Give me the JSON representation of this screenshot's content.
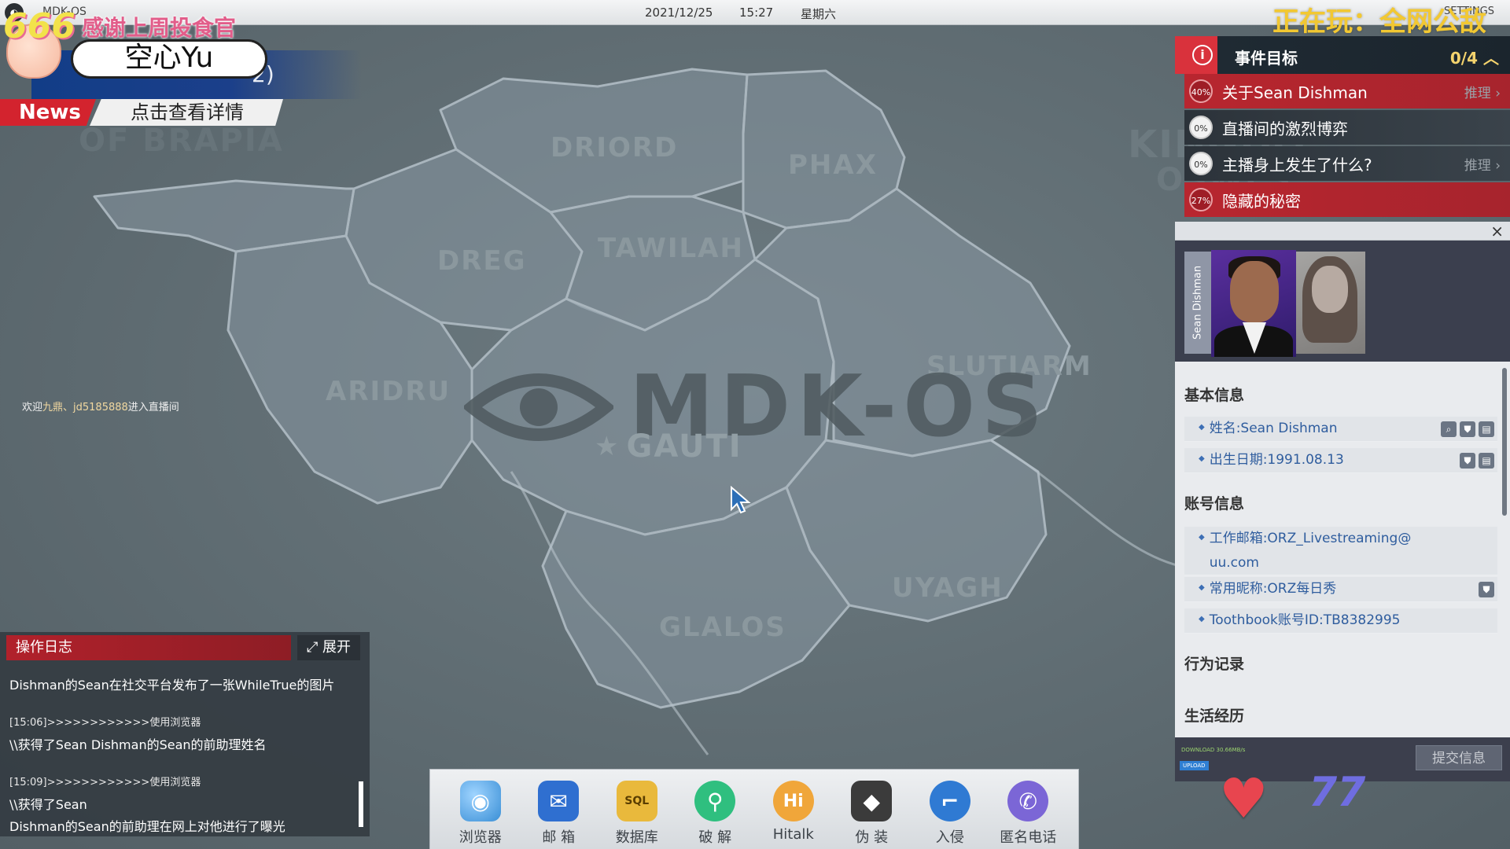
{
  "topbar": {
    "os_logo": "◐",
    "os_name": "MDK-OS",
    "date": "2021/12/25",
    "time": "15:27",
    "weekday": "星期六",
    "settings": "SETTINGS"
  },
  "stream_overlay": {
    "playing_text": "正在玩：全网公敌",
    "thanks_text": "感谢上周投食官",
    "num": "666",
    "streamer_name": "空心Yu",
    "banner_text": "2)",
    "news_tag": "News",
    "news_text": "点击查看详情",
    "welcome_prefix": "欢迎",
    "welcome_user": "九鼎、jd5185888",
    "welcome_suffix": "进入直播间",
    "heart_count": "77"
  },
  "map": {
    "watermark": "MDK-OS",
    "capital": "GAUTI",
    "regions": [
      "DRIORD",
      "PHAX",
      "DREG",
      "TAWILAH",
      "ARIDRU",
      "SLUTIARM",
      "UYAGH",
      "GLALOS",
      "KINGDO",
      "OSWES",
      "OF BRAPIA"
    ]
  },
  "goals": {
    "title": "事件目标",
    "count": "0/4",
    "items": [
      {
        "pct": "40%",
        "label": "关于Sean Dishman",
        "infer": "推理",
        "hot": true
      },
      {
        "pct": "0%",
        "label": "直播间的激烈博弈",
        "infer": "",
        "hot": false
      },
      {
        "pct": "0%",
        "label": "主播身上发生了什么?",
        "infer": "推理",
        "hot": false
      },
      {
        "pct": "27%",
        "label": "隐藏的秘密",
        "infer": "",
        "hot": true
      }
    ]
  },
  "profile": {
    "close": "×",
    "name_tag": "Sean Dishman",
    "sections": {
      "basic": "基本信息",
      "account": "账号信息",
      "behavior": "行为记录",
      "life": "生活经历"
    },
    "basic_rows": [
      "姓名:Sean Dishman",
      "出生日期:1991.08.13"
    ],
    "account_rows": [
      "工作邮箱:ORZ_Livestreaming@uu.com",
      "常用昵称:ORZ每日秀",
      "Toothbook账号ID:TB8382995"
    ],
    "footer": {
      "download": "DOWNLOAD 30.66MB/s",
      "upload": "UPLOAD",
      "submit": "提交信息"
    }
  },
  "oplog": {
    "title": "操作日志",
    "expand": "⤢ 展开",
    "lines": [
      "Dishman的Sean在社交平台发布了一张WhileTrue的图片",
      "[15:06]>>>>>>>>>>>>使用浏览器",
      "\\\\获得了Sean Dishman的Sean的前助理姓名",
      "[15:09]>>>>>>>>>>>>使用浏览器",
      "\\\\获得了Sean",
      "Dishman的Sean的前助理在网上对他进行了曝光"
    ]
  },
  "dock": {
    "items": [
      {
        "label": "浏览器",
        "icon": "globe-icon",
        "glyph": "◉",
        "color": "#3a8fd6"
      },
      {
        "label": "邮 箱",
        "icon": "mail-icon",
        "glyph": "✉",
        "color": "#2f6fd0"
      },
      {
        "label": "数据库",
        "icon": "database-icon",
        "glyph": "SQL",
        "color": "#e9b93c"
      },
      {
        "label": "破 解",
        "icon": "unlock-icon",
        "glyph": "⚲",
        "color": "#2fbf7f"
      },
      {
        "label": "Hitalk",
        "icon": "hitalk-icon",
        "glyph": "Hi",
        "color": "#f0a63a"
      },
      {
        "label": "伪 装",
        "icon": "disguise-icon",
        "glyph": "◆",
        "color": "#3b3b3b"
      },
      {
        "label": "入侵",
        "icon": "hook-icon",
        "glyph": "⌐",
        "color": "#2f7ad3"
      },
      {
        "label": "匿名电话",
        "icon": "phone-icon",
        "glyph": "✆",
        "color": "#7b66d6"
      }
    ]
  },
  "colors": {
    "accent_red": "#d3232e",
    "goal_hot": "#b8262f",
    "link_blue": "#2f5d9e",
    "dock_bg": "#e4e7ea"
  }
}
